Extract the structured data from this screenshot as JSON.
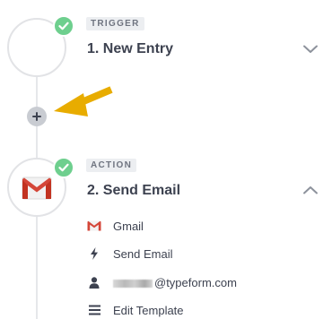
{
  "trigger": {
    "badge": "TRIGGER",
    "title": "1. New Entry",
    "status_icon": "check-icon",
    "toggle_icon": "chevron-down-icon"
  },
  "add_step": {
    "icon": "plus-icon"
  },
  "annotation": {
    "icon": "arrow-icon",
    "color": "#e8ac00"
  },
  "action": {
    "badge": "ACTION",
    "title": "2. Send Email",
    "app_icon": "gmail-icon",
    "status_icon": "check-icon",
    "toggle_icon": "chevron-up-icon",
    "details": [
      {
        "icon": "gmail-icon",
        "label": "Gmail"
      },
      {
        "icon": "bolt-icon",
        "label": "Send Email"
      },
      {
        "icon": "person-icon",
        "label": "@typeform.com"
      },
      {
        "icon": "lines-icon",
        "label": "Edit Template"
      }
    ]
  },
  "colors": {
    "success": "#6ecf8e",
    "accent_arrow": "#e8ac00",
    "text": "#3d4250",
    "muted": "#c9ccd2",
    "gmail_red": "#d44638"
  }
}
